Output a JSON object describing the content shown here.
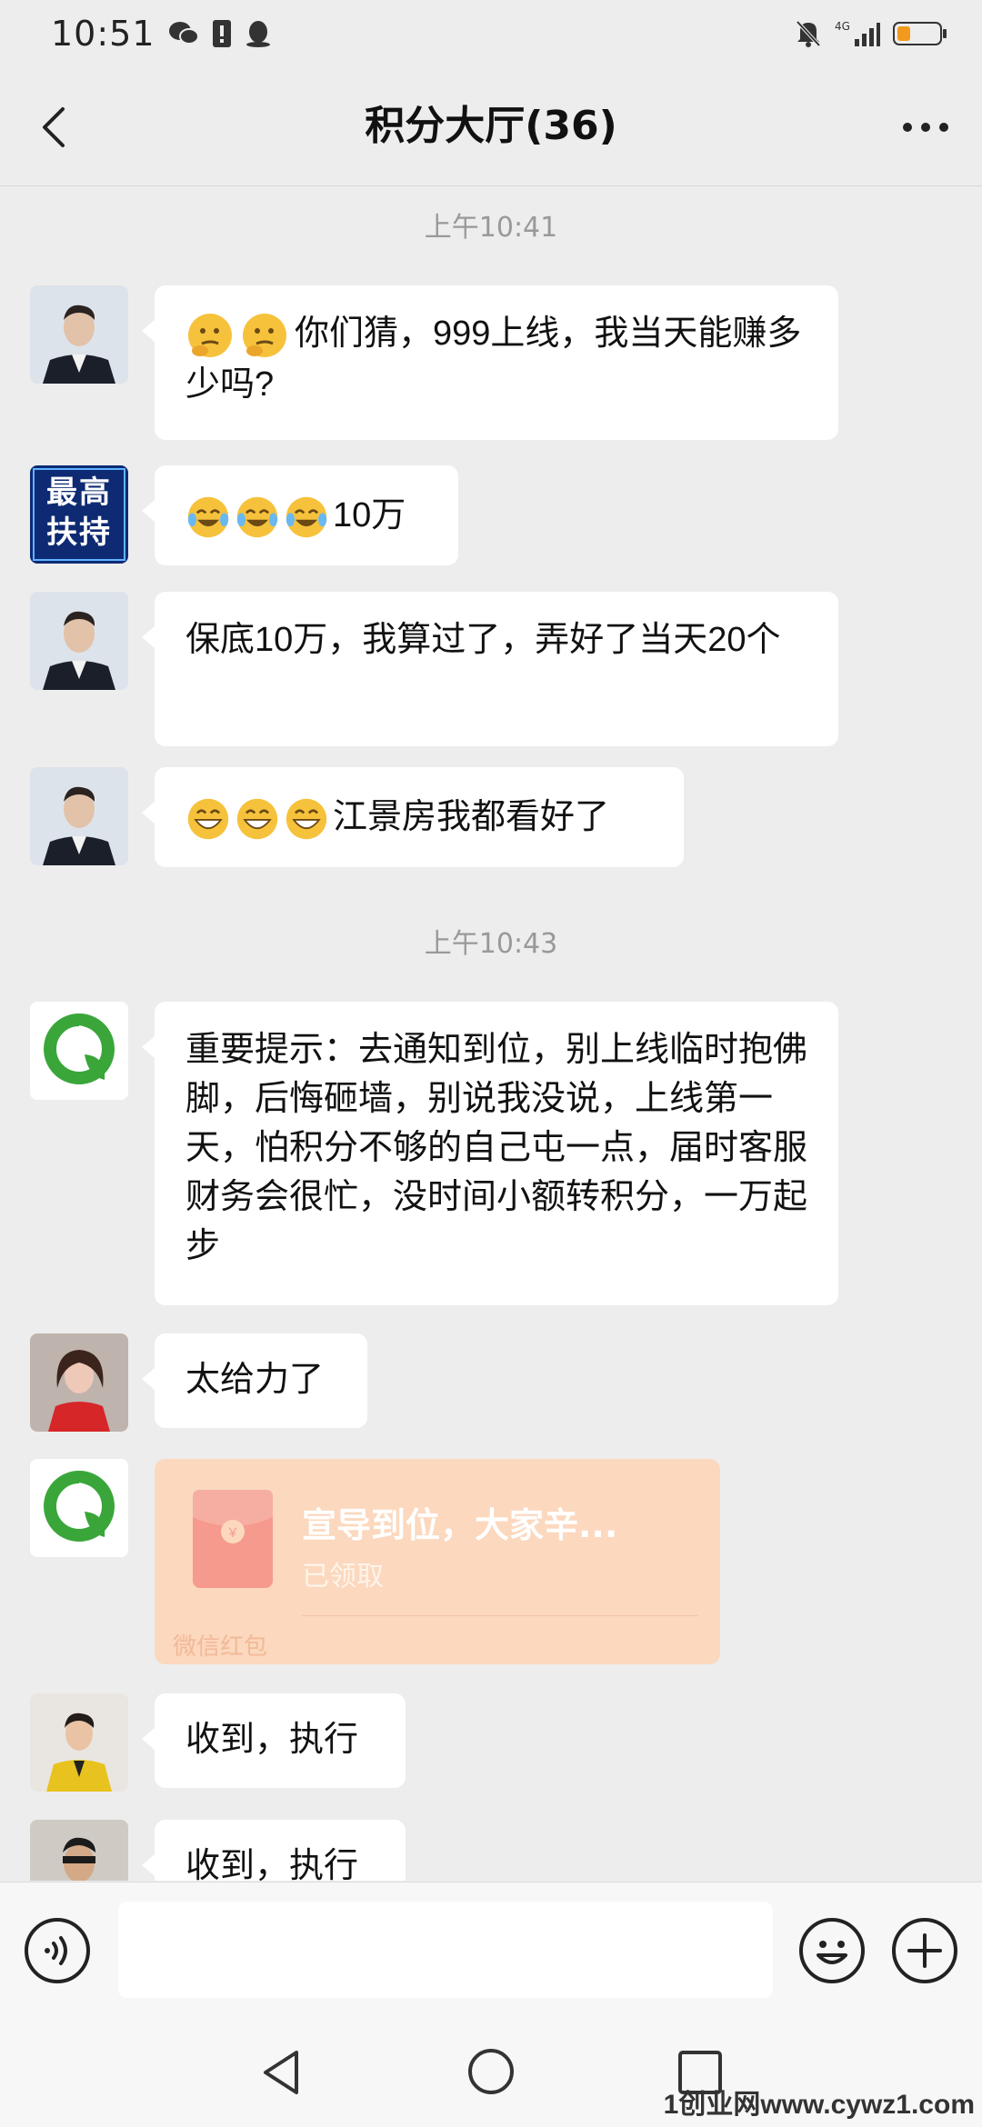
{
  "status_bar": {
    "time": "10:51",
    "network": "4G"
  },
  "header": {
    "title": "积分大厅(36)"
  },
  "messages": {
    "timestamp_1": "上午10:41",
    "timestamp_2": "上午10:43",
    "m1": {
      "text": "你们猜，999上线，我当天能赚多少吗?",
      "emoji": "thinking-face"
    },
    "m2": {
      "avatar_text": "最高扶持",
      "text": "10万",
      "emoji": "tears-of-joy"
    },
    "m3": {
      "text": "保底10万，我算过了，弄好了当天20个"
    },
    "m4": {
      "text": "江景房我都看好了",
      "emoji": "grinning-face"
    },
    "m5": {
      "text": "重要提示：去通知到位，别上线临时抱佛脚，后悔砸墙，别说我没说，上线第一天，怕积分不够的自己屯一点，届时客服财务会很忙，没时间小额转积分，一万起步"
    },
    "m6": {
      "text": "太给力了"
    },
    "m7": {
      "red_packet_title": "宣导到位，大家辛...",
      "red_packet_status": "已领取",
      "red_packet_label": "微信红包"
    },
    "m8": {
      "text": "收到，执行"
    },
    "m9": {
      "text": "收到，执行"
    }
  },
  "watermark": "1创业网www.cywz1.com",
  "colors": {
    "background": "#ededed",
    "bubble": "#ffffff",
    "red_packet": "#fbd8be",
    "brand_green": "#3aa63a"
  }
}
